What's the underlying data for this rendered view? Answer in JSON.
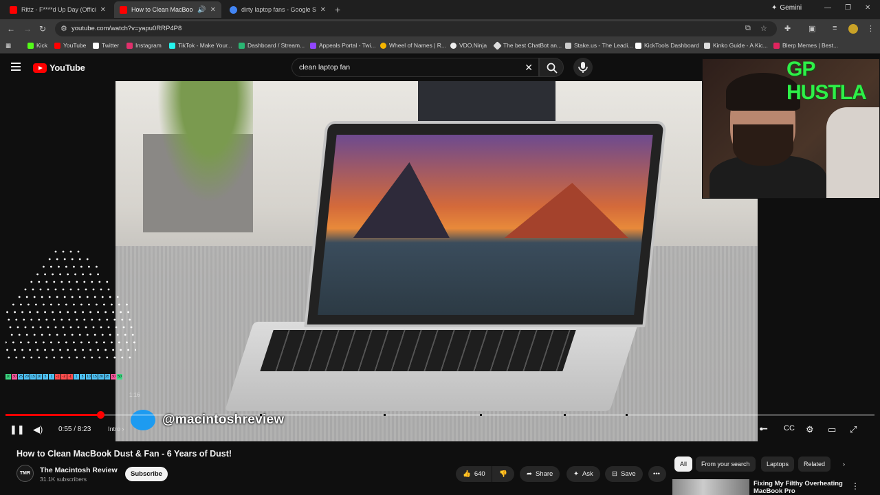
{
  "browser": {
    "tabs": [
      {
        "title": "Rittz - F****d Up Day (Official M",
        "favicon_color": "#ff0000",
        "active": false
      },
      {
        "title": "How to Clean MacBook Du",
        "favicon_color": "#ff0000",
        "active": true
      },
      {
        "title": "dirty laptop fans - Google Sear",
        "favicon_color": "#4285f4",
        "active": false
      }
    ],
    "gemini_label": "Gemini",
    "url": "youtube.com/watch?v=yapu0RRP4P8",
    "bookmarks": [
      {
        "label": "Kick",
        "color": "#53fc18"
      },
      {
        "label": "YouTube",
        "color": "#ff0000"
      },
      {
        "label": "Twitter",
        "color": "#ffffff"
      },
      {
        "label": "Instagram",
        "color": "#e1306c"
      },
      {
        "label": "TikTok - Make Your...",
        "color": "#25f4ee"
      },
      {
        "label": "Dashboard / Stream...",
        "color": "#2ab673"
      },
      {
        "label": "Appeals Portal - Twi...",
        "color": "#9146ff"
      },
      {
        "label": "Wheel of Names | R...",
        "color": "#f4b400"
      },
      {
        "label": "VDO.Ninja",
        "color": "#eeeeee"
      },
      {
        "label": "The best ChatBot an...",
        "color": "#dddddd"
      },
      {
        "label": "Stake.us - The Leadi...",
        "color": "#cccccc"
      },
      {
        "label": "KickTools Dashboard",
        "color": "#ffffff"
      },
      {
        "label": "Kinko Guide - A Kic...",
        "color": "#dddddd"
      },
      {
        "label": "Blerp Memes | Best...",
        "color": "#e0245e"
      }
    ]
  },
  "youtube": {
    "logo_text": "YouTube",
    "search_query": "clean laptop fan",
    "player": {
      "watermark": "@macintoshreview",
      "current_time": "0:55 / 8:23",
      "chapter": "Intro",
      "hover_time": "1:16",
      "progress": 0.109
    },
    "webcam_overlay_text": "GP HUSTLA",
    "visualizer_chips": [
      "10",
      "30",
      "25",
      "20",
      "15",
      "10",
      "5",
      "1",
      "-1",
      "-2",
      "-1",
      "1",
      "5",
      "10",
      "15",
      "20",
      "25",
      "30",
      "50"
    ],
    "video": {
      "title": "How to Clean MacBook Dust & Fan - 6 Years of Dust!",
      "channel": "The Macintosh Review",
      "channel_badge": "TMR",
      "subscribers": "31.1K subscribers",
      "subscribe_label": "Subscribe",
      "likes": "640",
      "share_label": "Share",
      "ask_label": "Ask",
      "save_label": "Save"
    },
    "filter_chips": [
      "All",
      "From your search",
      "Laptops",
      "Related"
    ],
    "recommendation": {
      "title": "Fixing My Filthy Overheating MacBook Pro"
    }
  }
}
